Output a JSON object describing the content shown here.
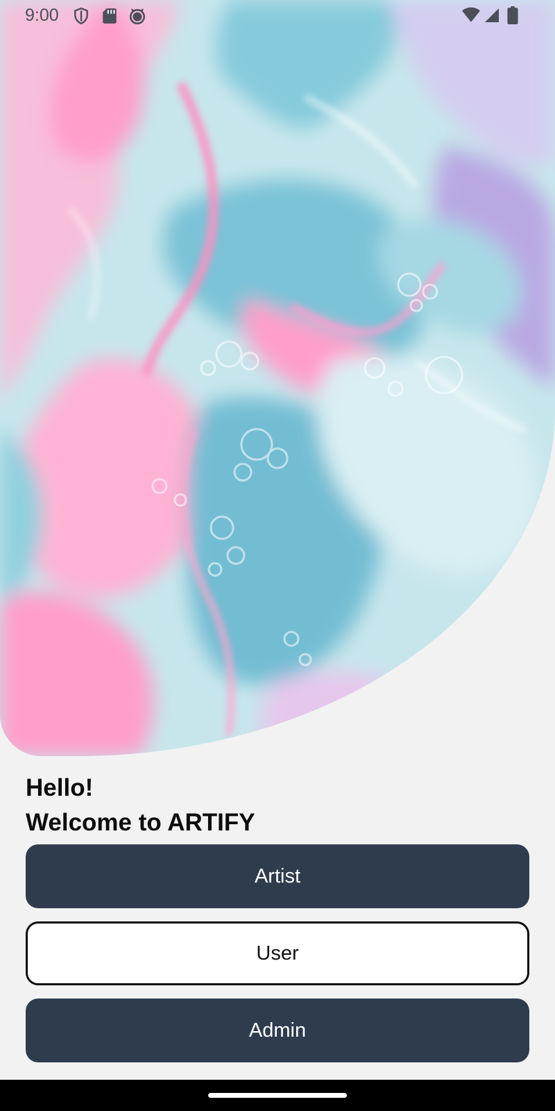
{
  "status_bar": {
    "time": "9:00",
    "left_icons": [
      "shield-icon",
      "sd-card-icon",
      "cat-face-icon"
    ],
    "right_icons": [
      "wifi-icon",
      "signal-icon",
      "battery-icon"
    ]
  },
  "hero": {
    "image": "fluid-art-pink-blue-marble",
    "colors": {
      "pink": "#ff9ec9",
      "blue": "#8fd0de",
      "light": "#dff1f4",
      "lavender": "#d7c8ec"
    }
  },
  "greeting": {
    "line1": "Hello!",
    "line2": "Welcome to ARTIFY"
  },
  "buttons": {
    "artist": "Artist",
    "user": "User",
    "admin": "Admin"
  },
  "colors": {
    "button_dark": "#2e3c4e",
    "background": "#f2f2f2"
  }
}
